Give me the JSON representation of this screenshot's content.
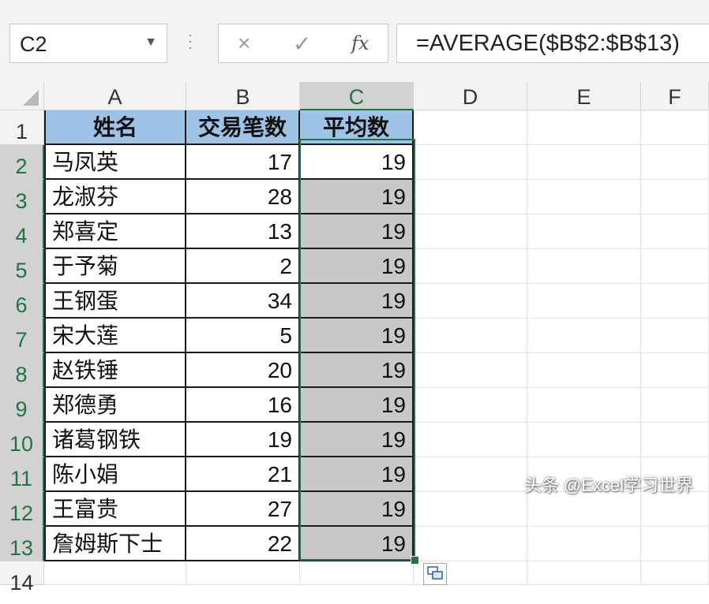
{
  "name_box": {
    "value": "C2"
  },
  "formula_bar": {
    "cancel_icon": "×",
    "enter_icon": "✓",
    "function_label": "fx",
    "formula": "=AVERAGE($B$2:$B$13)"
  },
  "columns": [
    "A",
    "B",
    "C",
    "D",
    "E",
    "F"
  ],
  "rows": [
    "1",
    "2",
    "3",
    "4",
    "5",
    "6",
    "7",
    "8",
    "9",
    "10",
    "11",
    "12",
    "13",
    "14"
  ],
  "table": {
    "headers": [
      "姓名",
      "交易笔数",
      "平均数"
    ],
    "records": [
      {
        "name": "马凤英",
        "count": "17",
        "avg": "19"
      },
      {
        "name": "龙淑芬",
        "count": "28",
        "avg": "19"
      },
      {
        "name": "郑喜定",
        "count": "13",
        "avg": "19"
      },
      {
        "name": "于予菊",
        "count": "2",
        "avg": "19"
      },
      {
        "name": "王钢蛋",
        "count": "34",
        "avg": "19"
      },
      {
        "name": "宋大莲",
        "count": "5",
        "avg": "19"
      },
      {
        "name": "赵铁锤",
        "count": "20",
        "avg": "19"
      },
      {
        "name": "郑德勇",
        "count": "16",
        "avg": "19"
      },
      {
        "name": "诸葛钢铁",
        "count": "19",
        "avg": "19"
      },
      {
        "name": "陈小娟",
        "count": "21",
        "avg": "19"
      },
      {
        "name": "王富贵",
        "count": "27",
        "avg": "19"
      },
      {
        "name": "詹姆斯下士",
        "count": "22",
        "avg": "19"
      }
    ]
  },
  "selection": {
    "active_cell": "C2",
    "range": "C2:C13"
  },
  "colors": {
    "accent": "#217346",
    "header_fill": "#9dc3e6",
    "selection_fill": "#c8c8c8"
  },
  "watermark": "头条 @Excel学习世界"
}
